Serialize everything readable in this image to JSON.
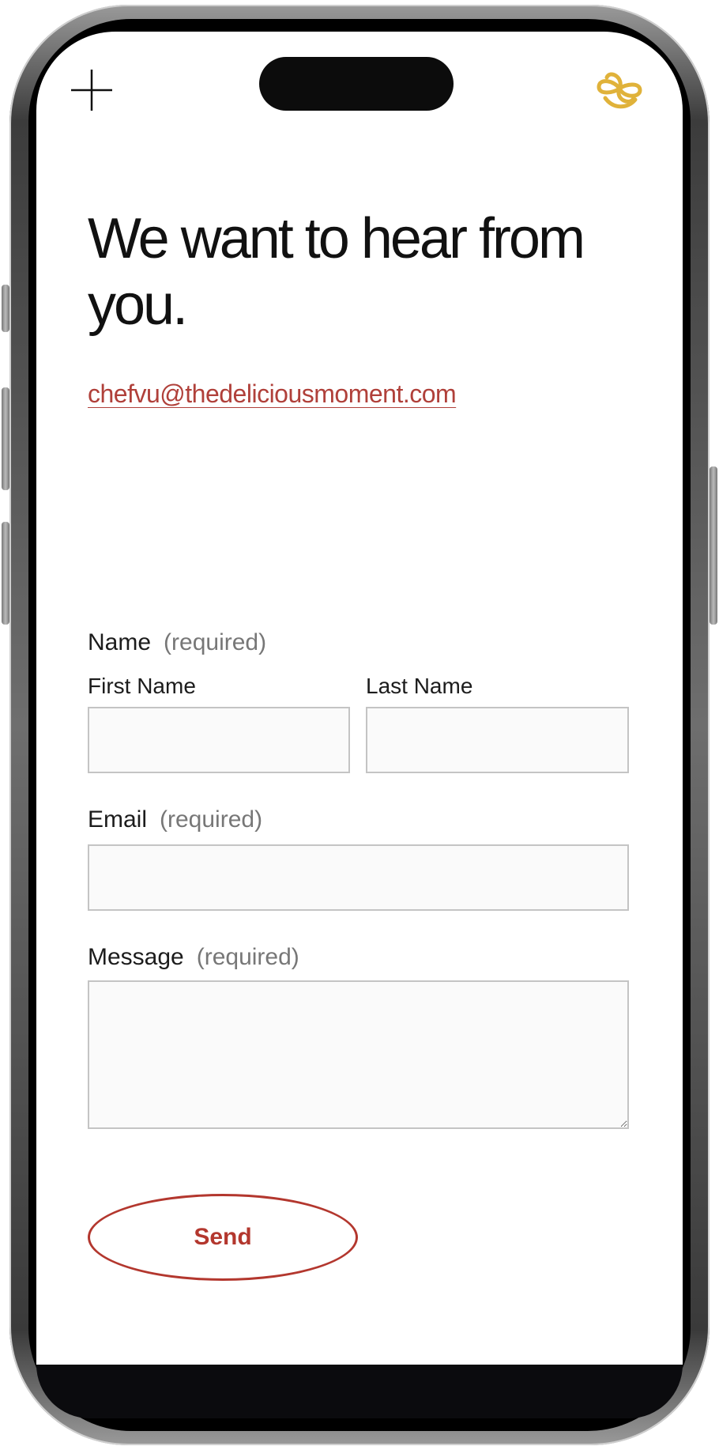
{
  "header": {
    "menu_icon": "plus-icon",
    "logo_icon": "infinity-smile-logo-icon",
    "logo_color": "#e0b23a"
  },
  "main": {
    "headline": "We want to hear from you.",
    "email": "chefvu@thedeliciousmoment.com"
  },
  "form": {
    "name_label": "Name",
    "name_required": "(required)",
    "first_name_label": "First Name",
    "last_name_label": "Last Name",
    "email_label": "Email",
    "email_required": "(required)",
    "message_label": "Message",
    "message_required": "(required)",
    "send_label": "Send"
  },
  "colors": {
    "accent": "#b3372e",
    "link": "#b0403a",
    "field_border": "#c4c4c4",
    "field_bg": "#fafafa"
  }
}
